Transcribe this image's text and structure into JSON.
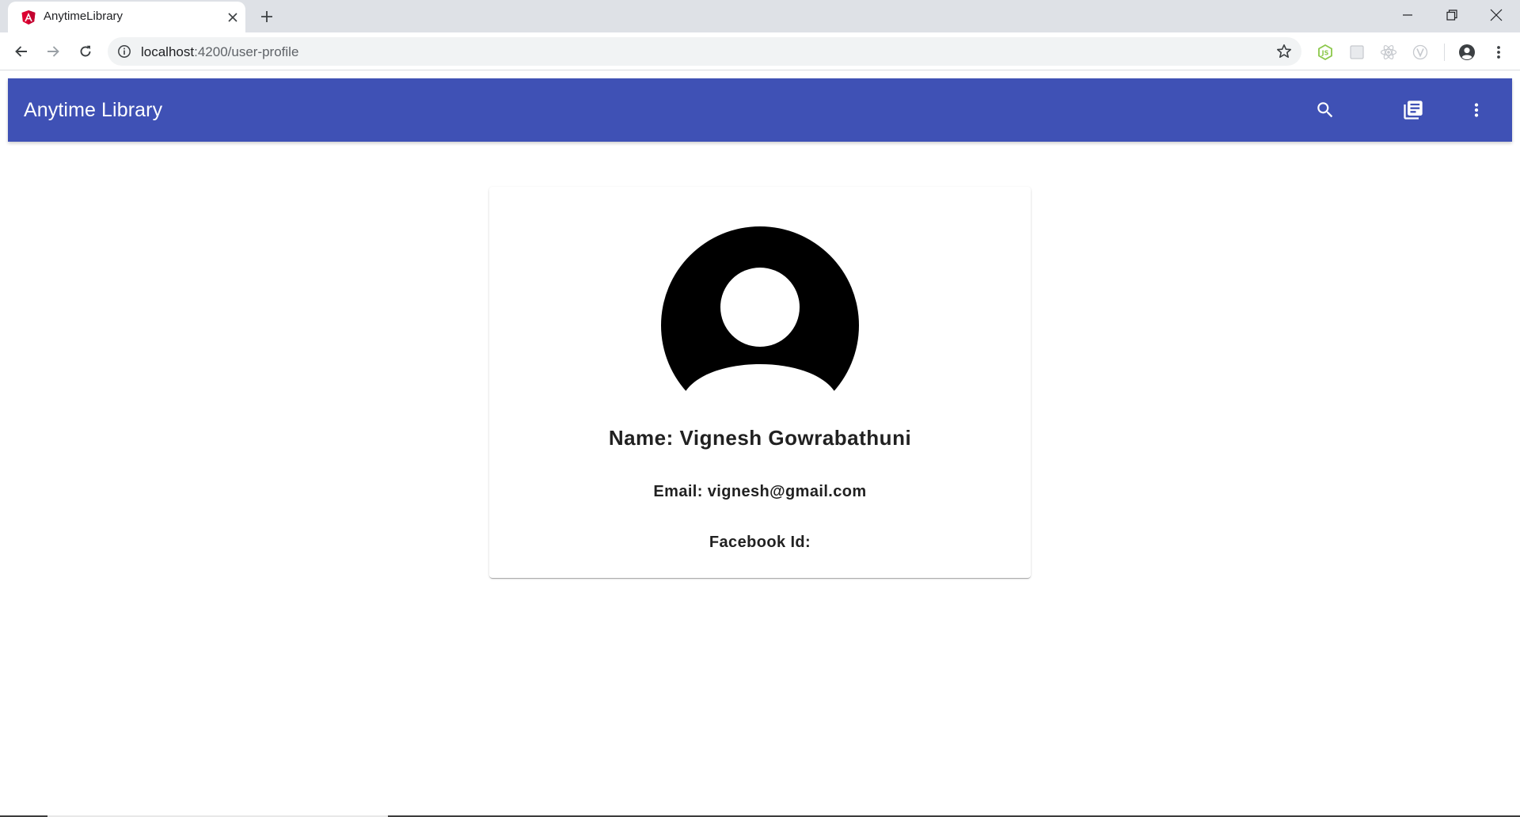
{
  "browser": {
    "tab": {
      "title": "AnytimeLibrary",
      "favicon": "angular-icon"
    },
    "url": {
      "host": "localhost",
      "path": ":4200/user-profile"
    },
    "extensions": [
      "nodejs-icon",
      "extension-square-icon",
      "react-icon",
      "vue-icon"
    ]
  },
  "app_bar": {
    "title": "Anytime Library",
    "color": "#3f51b5",
    "icons": [
      "search-icon",
      "library-books-icon",
      "more-vert-icon"
    ]
  },
  "profile": {
    "avatar": "account-circle-icon",
    "name_line": "Name: Vignesh Gowrabathuni",
    "email_line": "Email: vignesh@gmail.com",
    "facebook_line": "Facebook Id:"
  }
}
